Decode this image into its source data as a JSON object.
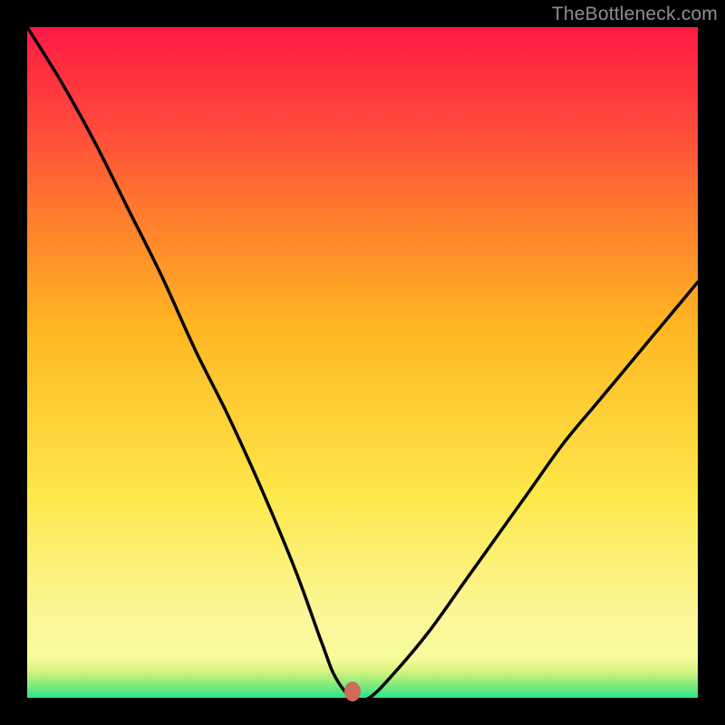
{
  "watermark": "TheBottleneck.com",
  "marker": {
    "x_pct": 48.5,
    "y_pct": 99.0,
    "color": "#cf6b57"
  },
  "chart_data": {
    "type": "line",
    "title": "",
    "xlabel": "",
    "ylabel": "",
    "xlim": [
      0,
      100
    ],
    "ylim": [
      0,
      100
    ],
    "grid": false,
    "legend": false,
    "series": [
      {
        "name": "bottleneck-curve",
        "x": [
          0,
          5,
          10,
          15,
          20,
          25,
          30,
          35,
          40,
          44,
          46,
          48.5,
          51,
          55,
          60,
          65,
          70,
          75,
          80,
          85,
          90,
          95,
          100
        ],
        "values": [
          100,
          92,
          83,
          73,
          63,
          52,
          42,
          31,
          19,
          8,
          3,
          0,
          0,
          4,
          10,
          17,
          24,
          31,
          38,
          44,
          50,
          56,
          62
        ]
      }
    ],
    "annotations": [
      {
        "type": "marker",
        "x": 48.5,
        "y": 0,
        "label": "optimal-point"
      }
    ],
    "background_gradient": {
      "type": "vertical",
      "stops": [
        {
          "pct": 0,
          "color": "#27e58d"
        },
        {
          "pct": 2,
          "color": "#86eb7b"
        },
        {
          "pct": 4,
          "color": "#d8f481"
        },
        {
          "pct": 6,
          "color": "#f8fb9b"
        },
        {
          "pct": 12,
          "color": "#fbf79a"
        },
        {
          "pct": 30,
          "color": "#fde84b"
        },
        {
          "pct": 55,
          "color": "#ffb722"
        },
        {
          "pct": 72,
          "color": "#ff7c2d"
        },
        {
          "pct": 85,
          "color": "#ff4a3a"
        },
        {
          "pct": 100,
          "color": "#ff1a45"
        }
      ]
    }
  }
}
